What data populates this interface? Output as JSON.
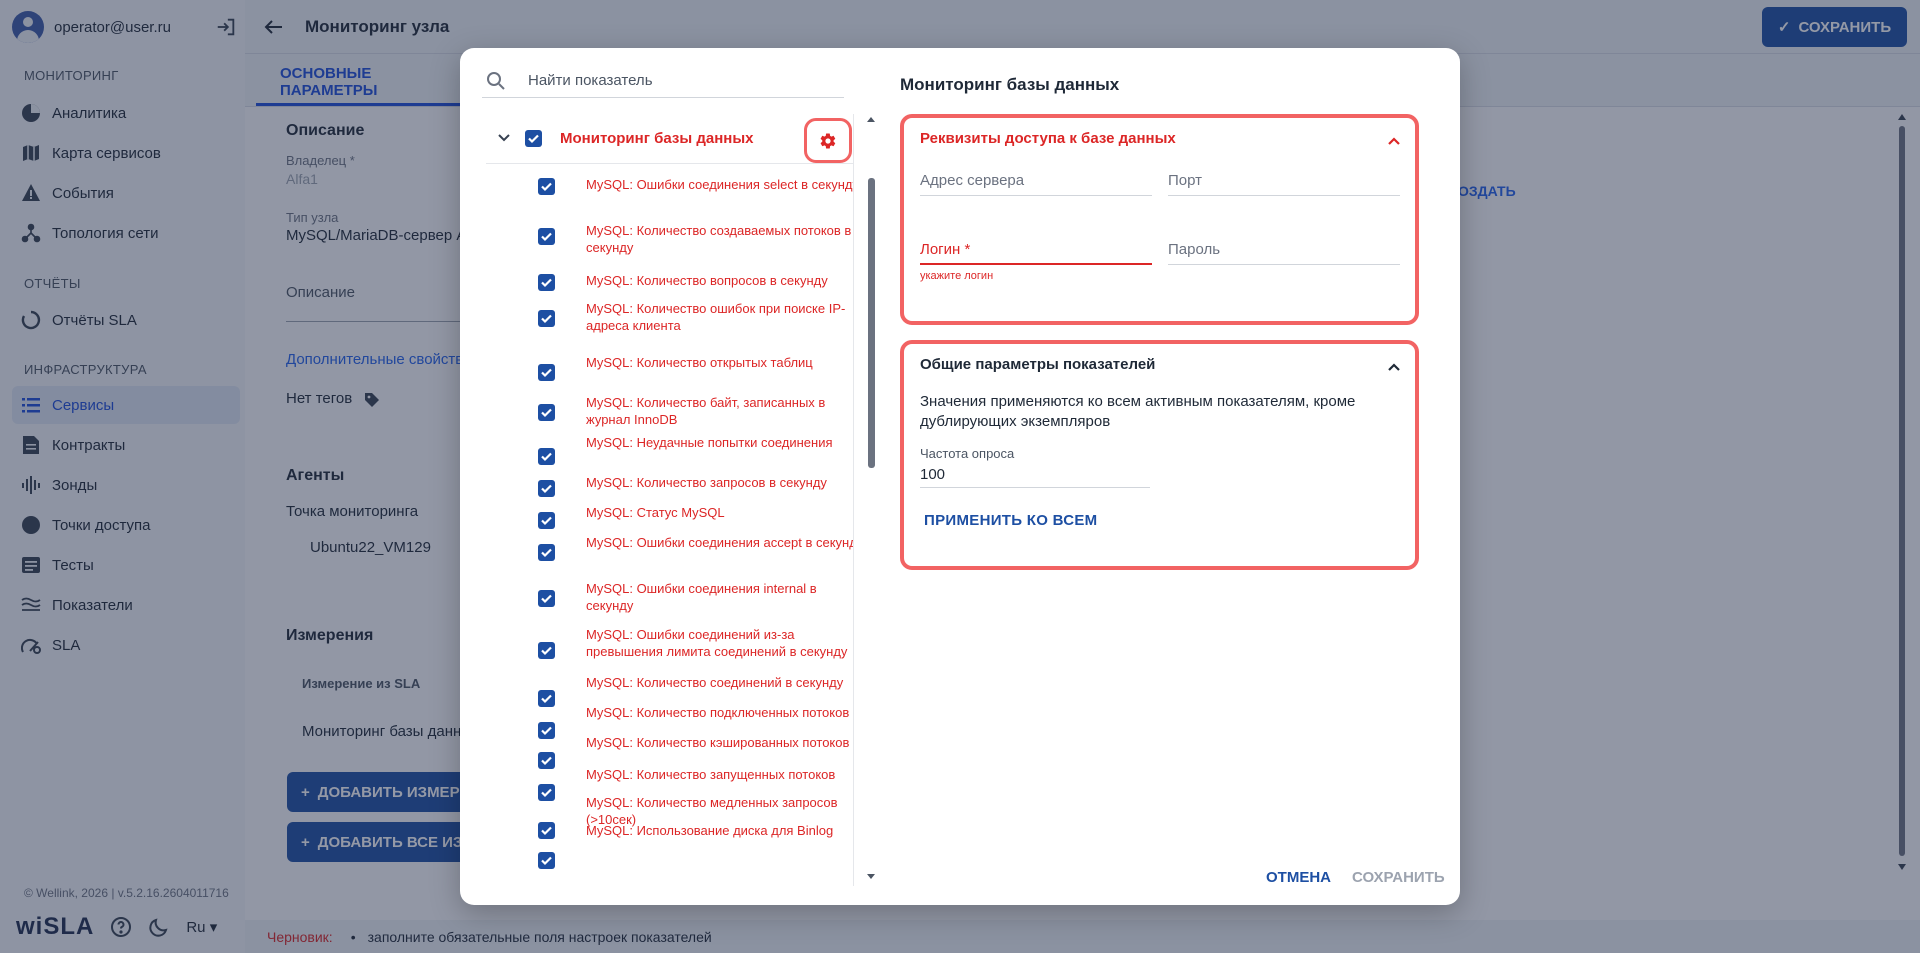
{
  "sidebar": {
    "user_email": "operator@user.ru",
    "sections": {
      "monitoring": "МОНИТОРИНГ",
      "reports": "ОТЧЁТЫ",
      "infrastructure": "ИНФРАСТРУКТУРА"
    },
    "items": {
      "analytics": "Аналитика",
      "service_map": "Карта сервисов",
      "events": "События",
      "topology": "Топология сети",
      "sla_reports": "Отчёты SLA",
      "services": "Сервисы",
      "contracts": "Контракты",
      "probes": "Зонды",
      "access_points": "Точки доступа",
      "tests": "Тесты",
      "indicators": "Показатели",
      "sla": "SLA"
    },
    "footer_copy": "© Wellink, 2026 | v.5.2.16.2604011716",
    "brand": "wiSLA",
    "lang": "Ru"
  },
  "header": {
    "title": "Мониторинг узла",
    "save_label": "СОХРАНИТЬ"
  },
  "tabs": {
    "main": "ОСНОВНЫЕ ПАРАМЕТРЫ"
  },
  "background": {
    "description_heading": "Описание",
    "owner_label": "Владелец *",
    "owner_value": "Alfa1",
    "node_type_label": "Тип узла",
    "node_type_value": "MySQL/MariaDB-сервер A",
    "description_placeholder": "Описание",
    "extra_props_link": "Дополнительные свойства",
    "no_tags": "Нет тегов",
    "agents_heading": "Агенты",
    "monitoring_point_label": "Точка мониторинга",
    "agent_value": "Ubuntu22_VM129",
    "measurements_heading": "Измерения",
    "measurement_col": "Измерение из SLA",
    "measurement_row": "Мониторинг базы данн",
    "add_measurement": "ДОБАВИТЬ ИЗМЕР",
    "add_all": "ДОБАВИТЬ ВСЕ ИЗ",
    "create_link": "ОЗДАТЬ"
  },
  "bottom_bar": {
    "draft_label": "Черновик:",
    "message": "заполните обязательные поля настроек показателей"
  },
  "modal": {
    "search_placeholder": "Найти показатель",
    "group_title": "Мониторинг базы данных",
    "metrics": [
      "MySQL: Ошибки соединения select в секунду",
      "MySQL: Количество создаваемых потоков в секунду",
      "MySQL: Количество вопросов в секунду",
      "MySQL: Количество ошибок при поиске IP-адреса клиента",
      "MySQL: Количество открытых таблиц",
      "MySQL: Количество байт, записанных в журнал InnoDB",
      "MySQL: Неудачные попытки соединения",
      "MySQL: Количество запросов в секунду",
      "MySQL: Статус MySQL",
      "MySQL: Ошибки соединения accept в секунду",
      "MySQL: Ошибки соединения internal в секунду",
      "MySQL: Ошибки соединений из-за превышения лимита соединений в секунду",
      "MySQL: Количество соединений в секунду",
      "MySQL: Количество подключенных потоков",
      "MySQL: Количество кэшированных потоков",
      "MySQL: Количество запущенных потоков",
      "MySQL: Количество медленных запросов (>10сек)",
      "MySQL: Использование диска для Binlog"
    ],
    "right_title": "Мониторинг базы данных",
    "credentials": {
      "heading": "Реквизиты доступа к базе данных",
      "server_address": "Адрес сервера",
      "port": "Порт",
      "login": "Логин *",
      "password": "Пароль",
      "login_error": "укажите логин"
    },
    "common": {
      "heading": "Общие параметры показателей",
      "description": "Значения применяются ко всем активным показателям, кроме дублирующих экземпляров",
      "poll_label": "Частота опроса",
      "poll_value": "100",
      "apply_all": "ПРИМЕНИТЬ КО ВСЕМ"
    },
    "cancel": "ОТМЕНА",
    "save": "СОХРАНИТЬ"
  },
  "colors": {
    "accent": "#1d4fa3",
    "error": "#dc2626",
    "highlight": "#f26363"
  }
}
